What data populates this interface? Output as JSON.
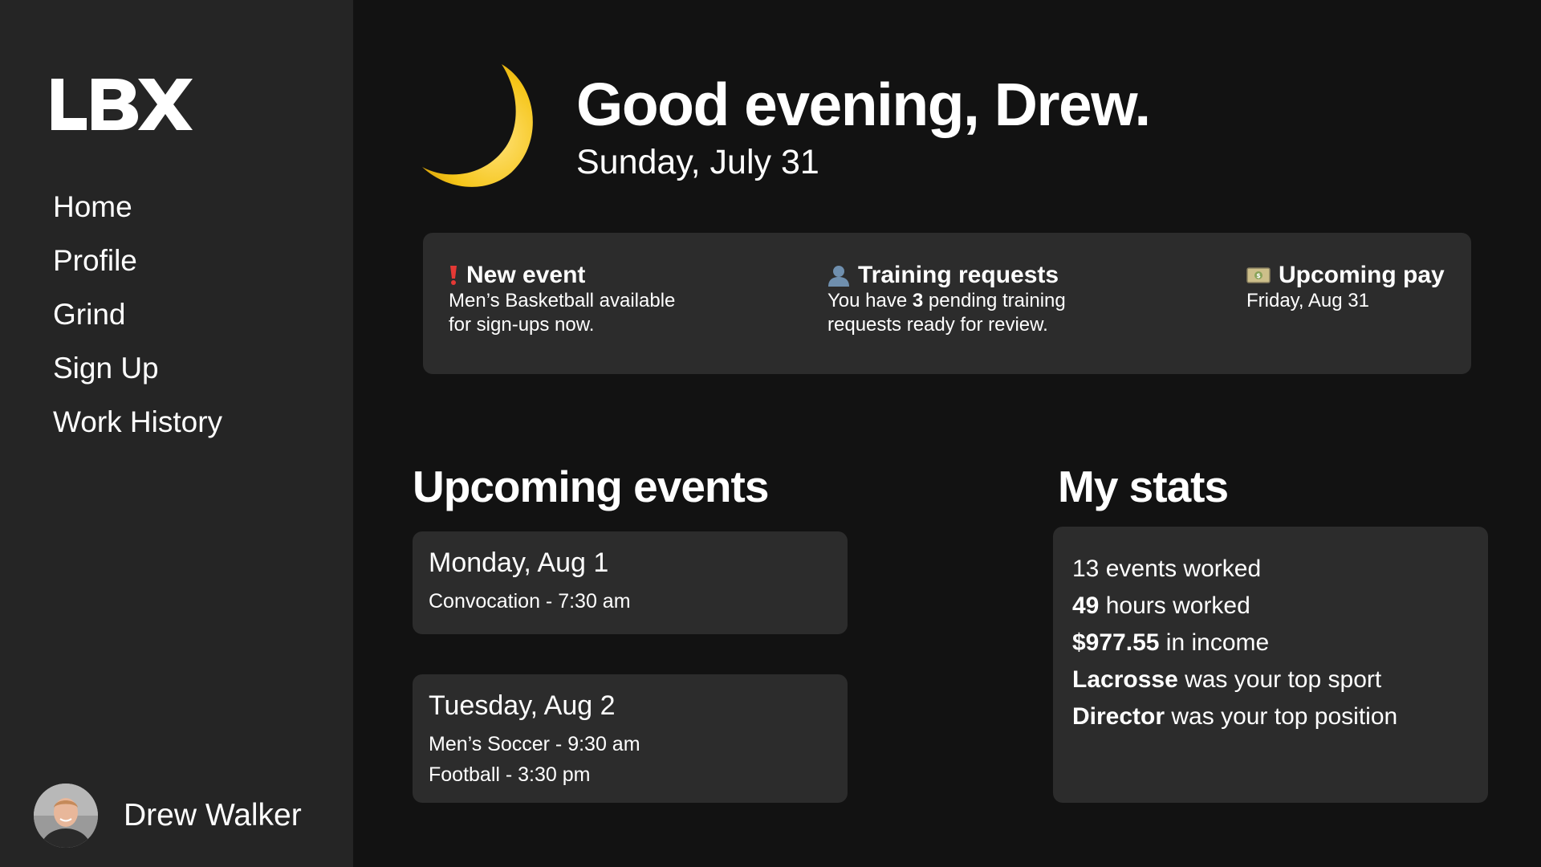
{
  "app": {
    "logo_text": "LBX"
  },
  "sidebar": {
    "nav": [
      {
        "label": "Home"
      },
      {
        "label": "Profile"
      },
      {
        "label": "Grind"
      },
      {
        "label": "Sign Up"
      },
      {
        "label": "Work History"
      }
    ],
    "user": {
      "name": "Drew Walker"
    }
  },
  "header": {
    "greeting": "Good evening, Drew.",
    "date": "Sunday, July 31",
    "icon": "crescent-moon-icon"
  },
  "notifications": [
    {
      "icon": "exclamation-icon",
      "title": "New event",
      "body": "Men’s Basketball available for sign-ups now."
    },
    {
      "icon": "person-icon",
      "title": "Training requests",
      "body_prefix": "You have ",
      "body_count": "3",
      "body_suffix": " pending training requests ready for review."
    },
    {
      "icon": "money-icon",
      "title": "Upcoming pay",
      "body": "Friday, Aug 31"
    }
  ],
  "upcoming": {
    "title": "Upcoming events",
    "days": [
      {
        "day": "Monday, Aug 1",
        "events": [
          "Convocation - 7:30 am"
        ]
      },
      {
        "day": "Tuesday, Aug 2",
        "events": [
          "Men’s Soccer - 9:30 am",
          "Football - 3:30 pm"
        ]
      }
    ]
  },
  "stats": {
    "title": "My stats",
    "lines": [
      {
        "value": "13",
        "text": " events worked",
        "value_bold": false
      },
      {
        "value": "49",
        "text": " hours worked",
        "value_bold": true
      },
      {
        "value": "$977.55",
        "text": " in income",
        "value_bold": true
      },
      {
        "value": "Lacrosse",
        "text": " was your top sport",
        "value_bold": true
      },
      {
        "value": "Director",
        "text": " was your top position",
        "value_bold": true
      }
    ]
  },
  "colors": {
    "sidebar_bg": "#252525",
    "page_bg": "#121212",
    "card_bg": "#2c2c2c",
    "moon": "#f5c518",
    "alert": "#e53935"
  }
}
